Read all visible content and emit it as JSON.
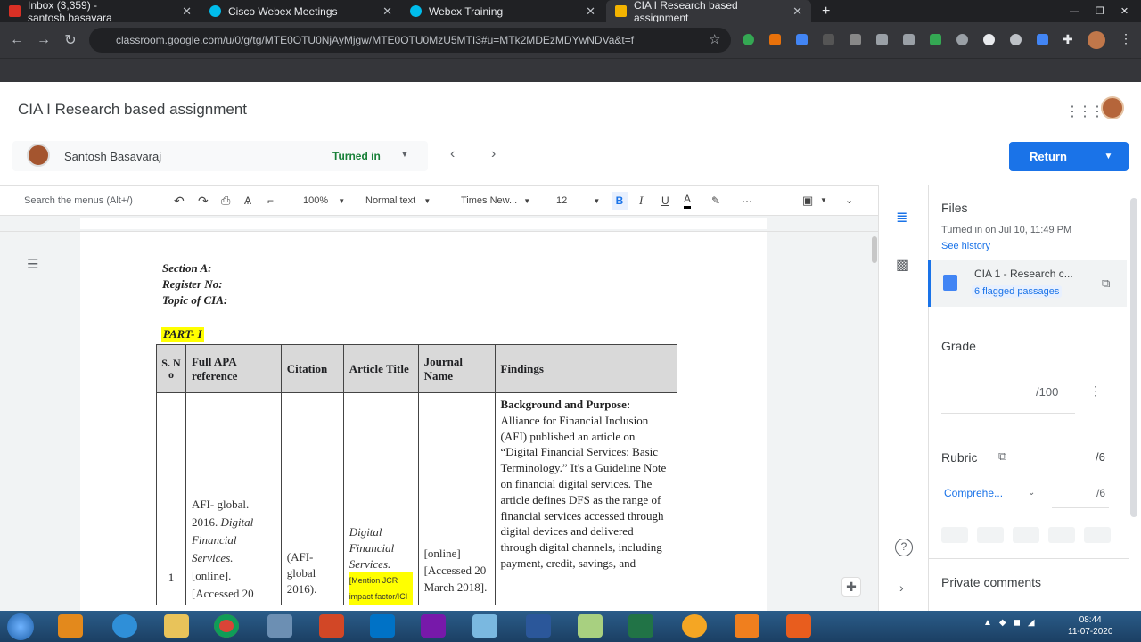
{
  "browser": {
    "tabs": [
      {
        "label": "Inbox (3,359) - santosh.basavara",
        "color": "#d93025"
      },
      {
        "label": "Cisco Webex Meetings",
        "color": "#00bceb"
      },
      {
        "label": "Webex Training",
        "color": "#00bceb"
      },
      {
        "label": "CIA I Research based assignment",
        "color": "#f4b400"
      }
    ],
    "url": "classroom.google.com/u/0/g/tg/MTE0OTU0NjAyMjgw/MTE0OTU0MzU5MTI3#u=MTk2MDEzMDYwNDVa&t=f"
  },
  "header": {
    "title": "CIA I Research based assignment",
    "student_name": "Santosh Basavaraj",
    "status": "Turned in",
    "return_label": "Return"
  },
  "toolbar": {
    "search_placeholder": "Search the menus (Alt+/)",
    "zoom": "100%",
    "style": "Normal text",
    "font": "Times New...",
    "size": "12",
    "bold": "B",
    "italic": "I",
    "underline": "U",
    "text_color": "A",
    "more": "···"
  },
  "document": {
    "section": "Section A:",
    "register": "Register No:",
    "topic": "Topic of CIA:",
    "part": "PART- I",
    "table": {
      "headers": [
        "S. N o",
        "Full APA reference",
        "Citation",
        "Article Title",
        "Journal Name",
        "Findings"
      ],
      "row": {
        "sno": "1",
        "reference_a": "AFI- global. 2016.",
        "reference_b": "Digital Financial Services.",
        "reference_c": "[online]. [Accessed 20",
        "citation": "(AFI-global 2016).",
        "title": "Digital Financial Services.",
        "title_note": "[Mention JCR impact factor/ICI",
        "journal": "[online] [Accessed 20 March 2018].",
        "findings_head": "Background and Purpose:",
        "findings": "Alliance for Financial Inclusion (AFI) published an article on “Digital Financial Services: Basic Terminology.” It's a Guideline Note on financial digital services. The article defines DFS as the range of financial services accessed through digital devices and delivered through digital channels, including payment, credit, savings, and"
      }
    }
  },
  "side_panel": {
    "files_heading": "Files",
    "turned_in_date": "Turned in on Jul 10, 11:49 PM",
    "see_history": "See history",
    "file_name": "CIA 1 - Research c...",
    "flagged": "6 flagged passages",
    "grade_heading": "Grade",
    "grade_max": "/100",
    "rubric_heading": "Rubric",
    "rubric_max": "/6",
    "criterion": "Comprehe...",
    "criterion_score": "/6",
    "private_comments": "Private comments"
  },
  "taskbar": {
    "time": "08:44",
    "date": "11-07-2020"
  },
  "colors": {
    "accent": "#1a73e8",
    "turned_in": "#188038",
    "highlight": "#ffff00"
  }
}
